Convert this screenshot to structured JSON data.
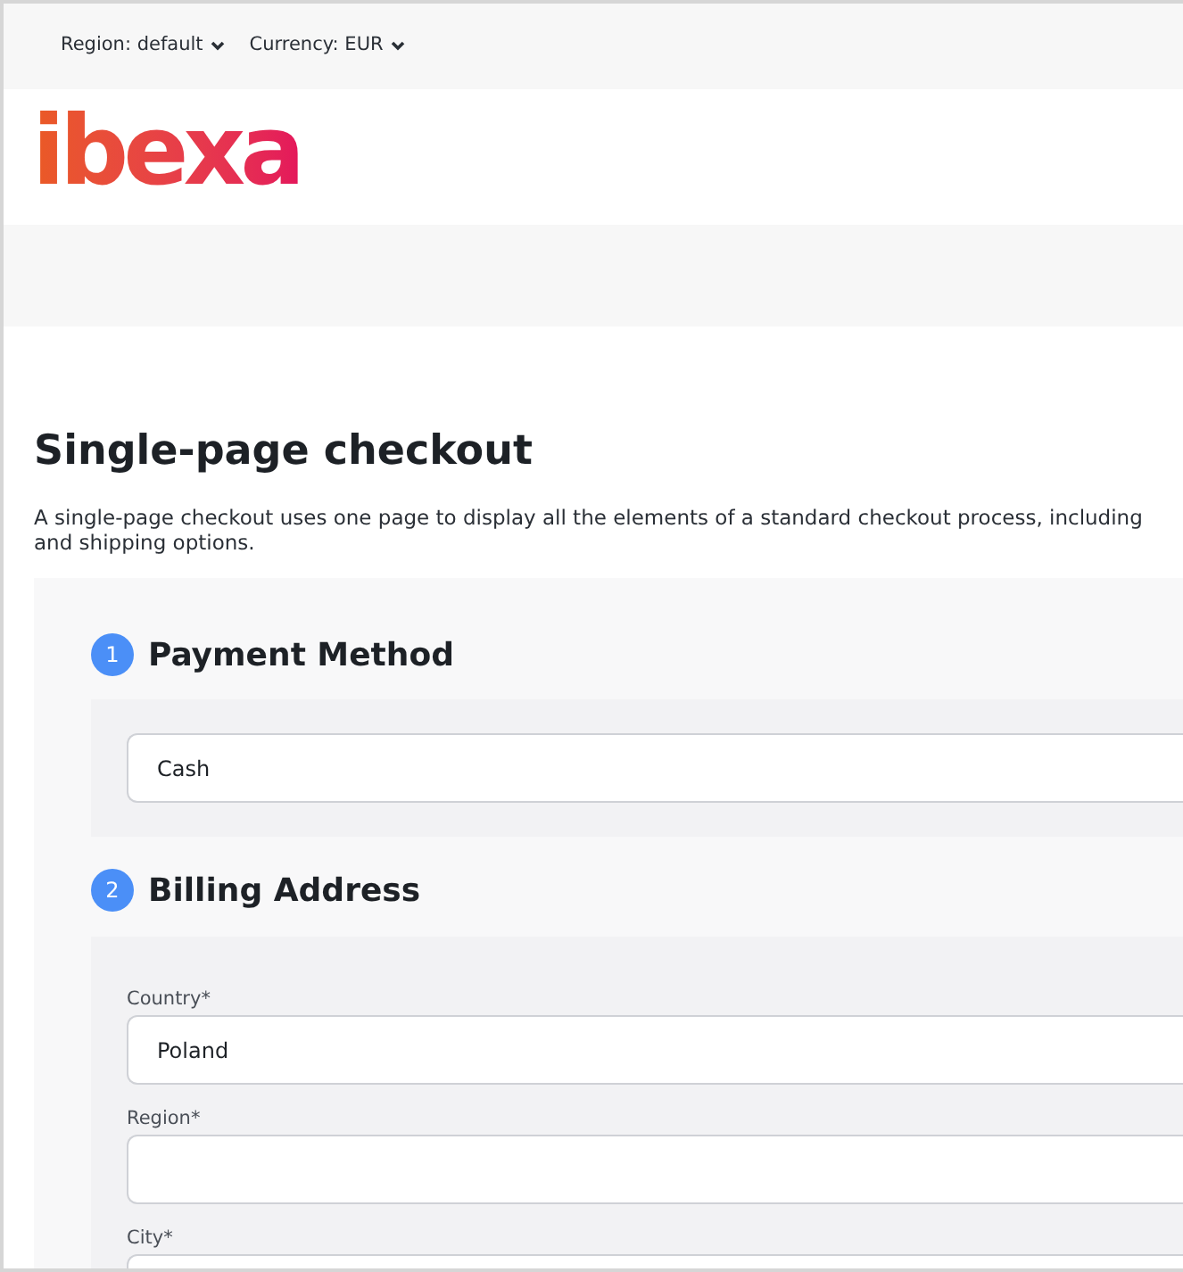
{
  "top_bar": {
    "selectors": [
      {
        "label": "Region: default"
      },
      {
        "label": "Currency: EUR"
      }
    ]
  },
  "logo": {
    "text": "ibexa"
  },
  "page": {
    "title": "Single-page checkout",
    "description_lines": [
      "A single-page checkout uses one page to display all the elements of a standard checkout process, including",
      "and shipping options."
    ]
  },
  "sections": [
    {
      "number": "1",
      "title": "Payment Method",
      "fields": [
        {
          "value": "Cash"
        }
      ]
    },
    {
      "number": "2",
      "title": "Billing Address",
      "fields": [
        {
          "label": "Country*",
          "value": "Poland"
        },
        {
          "label": "Region*"
        },
        {
          "label": "City*"
        }
      ]
    }
  ]
}
